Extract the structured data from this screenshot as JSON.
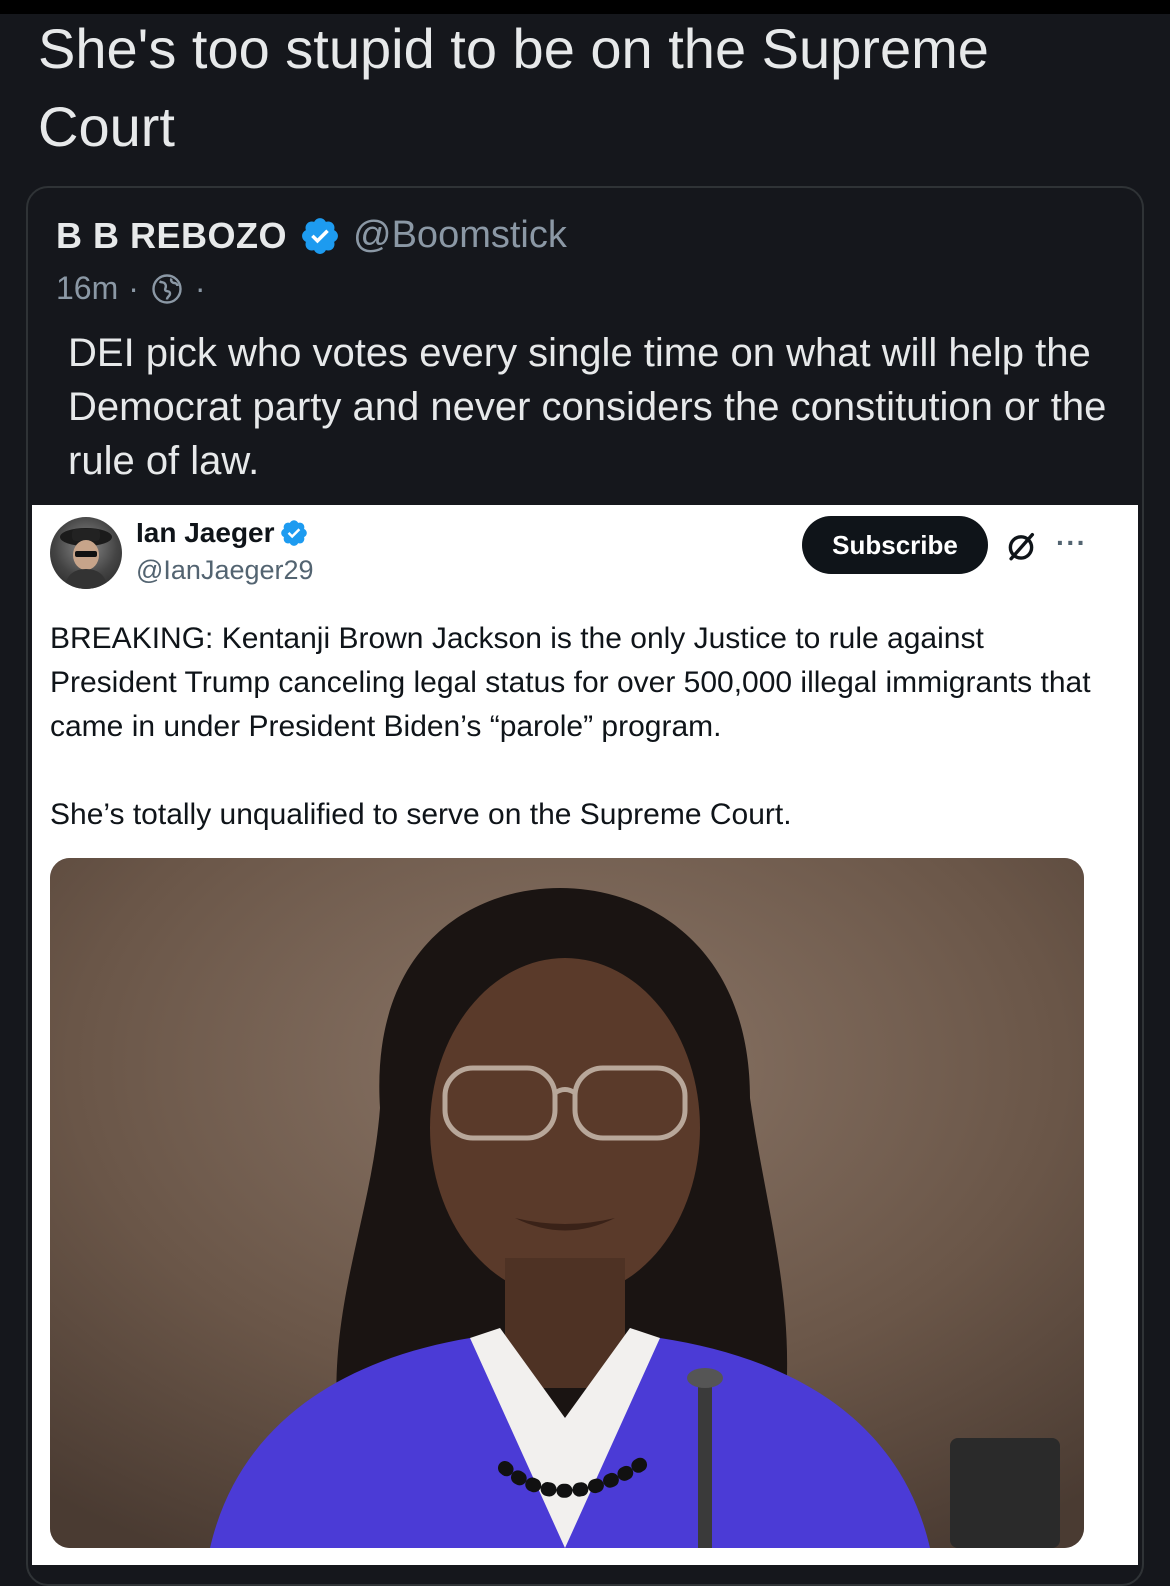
{
  "post": {
    "text": "She's too stupid to be on the Supreme Court"
  },
  "quote": {
    "author_name": "B B REBOZO",
    "author_handle": "@Boomstick",
    "time": "16m",
    "meta_separator": "·",
    "text": "DEI pick who votes every single time on what will help the Democrat party and never considers the constitution or the rule of law."
  },
  "embedded_tweet": {
    "author_name": "Ian Jaeger",
    "author_handle": "@IanJaeger29",
    "subscribe_label": "Subscribe",
    "more_label": "···",
    "text_1": "BREAKING: Kentanji Brown Jackson is the only Justice to rule against President Trump canceling legal status for over 500,000 illegal immigrants that came in under President Biden’s “parole” program.",
    "text_2": "She’s totally unqualified to serve on the Supreme Court."
  },
  "icons": {
    "verified": "verified-badge-icon",
    "globe": "globe-icon",
    "grok": "grok-icon",
    "more": "more-icon"
  },
  "colors": {
    "background": "#15171c",
    "text_primary": "#e7e9ea",
    "text_secondary": "#8b98a5",
    "verified_blue": "#1d9bf0",
    "embed_background": "#ffffff",
    "subscribe_background": "#0f1419"
  }
}
